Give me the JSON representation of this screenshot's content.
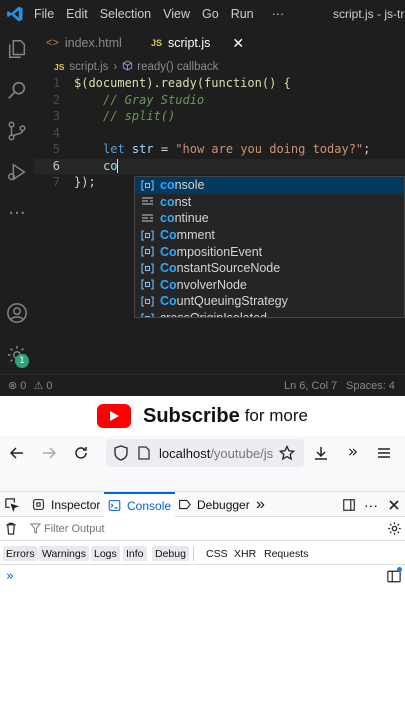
{
  "vscode": {
    "menu": [
      "File",
      "Edit",
      "Selection",
      "View",
      "Go",
      "Run",
      "···"
    ],
    "window_title": "script.js - js-trai",
    "tabs": [
      {
        "icon": "<>",
        "label": "index.html",
        "active": false
      },
      {
        "icon": "JS",
        "label": "script.js",
        "active": true,
        "close": "✕"
      }
    ],
    "breadcrumb": {
      "file_icon": "JS",
      "file": "script.js",
      "sep": "›",
      "symbol": "ready() callback"
    },
    "line_numbers": [
      "1",
      "2",
      "3",
      "4",
      "5",
      "6",
      "7"
    ],
    "code": {
      "l1_a": "$(document).ready(function() {",
      "l2": "// Gray Studio",
      "l3": "// split()",
      "l5_kw": "let",
      "l5_var": "str",
      "l5_eq": " = ",
      "l5_str": "\"how are you doing today?\"",
      "l5_end": ";",
      "l6": "co",
      "l7": "});"
    },
    "suggestions": [
      {
        "icon": "var",
        "match": "co",
        "rest": "nsole",
        "selected": true
      },
      {
        "icon": "kw",
        "match": "co",
        "rest": "nst"
      },
      {
        "icon": "kw",
        "match": "co",
        "rest": "ntinue"
      },
      {
        "icon": "var",
        "match": "Co",
        "rest": "mment"
      },
      {
        "icon": "var",
        "match": "Co",
        "rest": "mpositionEvent"
      },
      {
        "icon": "var",
        "match": "Co",
        "rest": "nstantSourceNode"
      },
      {
        "icon": "var",
        "match": "Co",
        "rest": "nvolverNode"
      },
      {
        "icon": "var",
        "match": "Co",
        "rest": "untQueuingStrategy"
      },
      {
        "icon": "var",
        "match": "",
        "rest": "crossOriginIsolated"
      }
    ],
    "status": {
      "errors": "0",
      "warnings": "0",
      "position": "Ln 6, Col 7",
      "spaces": "Spaces: 4"
    },
    "badge": "1"
  },
  "banner": {
    "subscribe": "Subscribe",
    "more": "for more"
  },
  "browser": {
    "url_host": "localhost",
    "url_path": "/youtube/js"
  },
  "devtools": {
    "tabs": {
      "inspector": "Inspector",
      "console": "Console",
      "debugger": "Debugger",
      "more": "»"
    },
    "filter_placeholder": "Filter Output",
    "categories": [
      "Errors",
      "Warnings",
      "Logs",
      "Info",
      "Debug"
    ],
    "net_categories": [
      "CSS",
      "XHR",
      "Requests"
    ],
    "prompt": "»"
  },
  "colors": {
    "accent": "#0060df",
    "youtube_red": "#ff0000",
    "vscode_bg": "#1e1e1e",
    "suggest_selected": "#04395e"
  }
}
